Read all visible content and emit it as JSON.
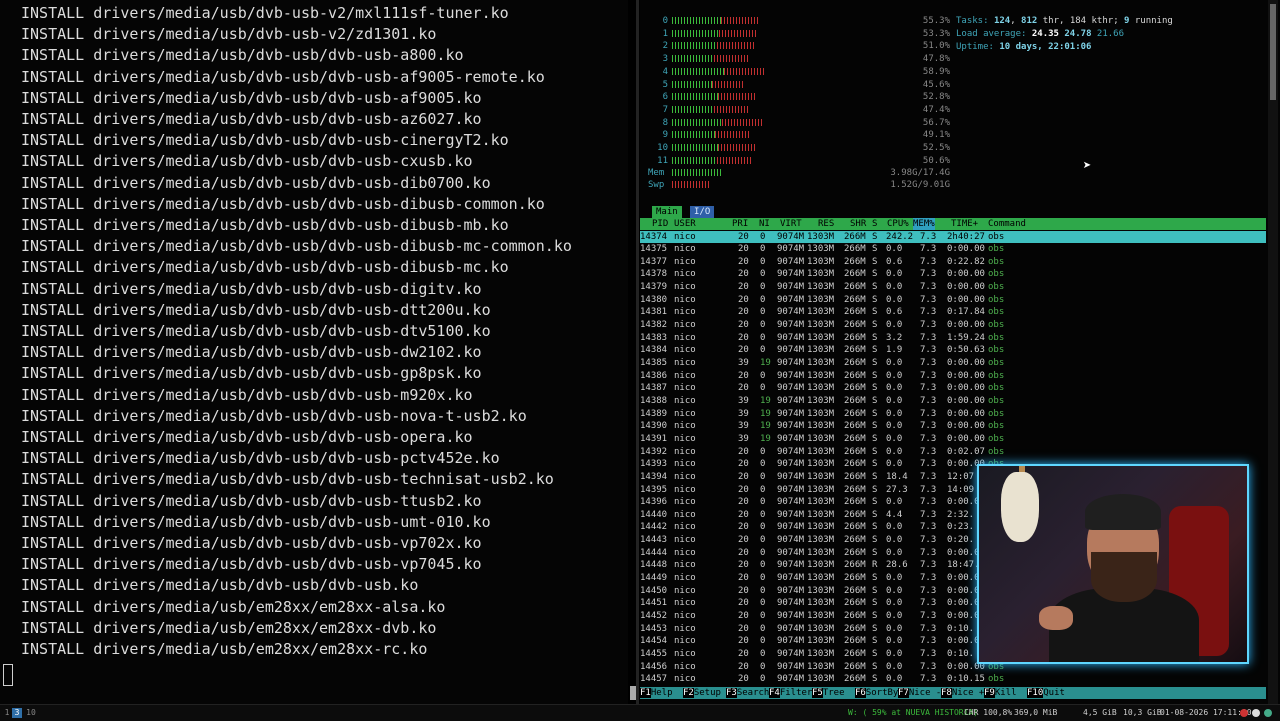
{
  "left_terminal": {
    "lines": [
      "INSTALL drivers/media/usb/dvb-usb-v2/mxl111sf-tuner.ko",
      "INSTALL drivers/media/usb/dvb-usb-v2/zd1301.ko",
      "INSTALL drivers/media/usb/dvb-usb/dvb-usb-a800.ko",
      "INSTALL drivers/media/usb/dvb-usb/dvb-usb-af9005-remote.ko",
      "INSTALL drivers/media/usb/dvb-usb/dvb-usb-af9005.ko",
      "INSTALL drivers/media/usb/dvb-usb/dvb-usb-az6027.ko",
      "INSTALL drivers/media/usb/dvb-usb/dvb-usb-cinergyT2.ko",
      "INSTALL drivers/media/usb/dvb-usb/dvb-usb-cxusb.ko",
      "INSTALL drivers/media/usb/dvb-usb/dvb-usb-dib0700.ko",
      "INSTALL drivers/media/usb/dvb-usb/dvb-usb-dibusb-common.ko",
      "INSTALL drivers/media/usb/dvb-usb/dvb-usb-dibusb-mb.ko",
      "INSTALL drivers/media/usb/dvb-usb/dvb-usb-dibusb-mc-common.ko",
      "INSTALL drivers/media/usb/dvb-usb/dvb-usb-dibusb-mc.ko",
      "INSTALL drivers/media/usb/dvb-usb/dvb-usb-digitv.ko",
      "INSTALL drivers/media/usb/dvb-usb/dvb-usb-dtt200u.ko",
      "INSTALL drivers/media/usb/dvb-usb/dvb-usb-dtv5100.ko",
      "INSTALL drivers/media/usb/dvb-usb/dvb-usb-dw2102.ko",
      "INSTALL drivers/media/usb/dvb-usb/dvb-usb-gp8psk.ko",
      "INSTALL drivers/media/usb/dvb-usb/dvb-usb-m920x.ko",
      "INSTALL drivers/media/usb/dvb-usb/dvb-usb-nova-t-usb2.ko",
      "INSTALL drivers/media/usb/dvb-usb/dvb-usb-opera.ko",
      "INSTALL drivers/media/usb/dvb-usb/dvb-usb-pctv452e.ko",
      "INSTALL drivers/media/usb/dvb-usb/dvb-usb-technisat-usb2.ko",
      "INSTALL drivers/media/usb/dvb-usb/dvb-usb-ttusb2.ko",
      "INSTALL drivers/media/usb/dvb-usb/dvb-usb-umt-010.ko",
      "INSTALL drivers/media/usb/dvb-usb/dvb-usb-vp702x.ko",
      "INSTALL drivers/media/usb/dvb-usb/dvb-usb-vp7045.ko",
      "INSTALL drivers/media/usb/dvb-usb/dvb-usb.ko",
      "INSTALL drivers/media/usb/em28xx/em28xx-alsa.ko",
      "INSTALL drivers/media/usb/em28xx/em28xx-dvb.ko",
      "INSTALL drivers/media/usb/em28xx/em28xx-rc.ko"
    ]
  },
  "htop": {
    "cpus": [
      {
        "id": "0",
        "pct": "55.3%",
        "usage": 0.553
      },
      {
        "id": "1",
        "pct": "53.3%",
        "usage": 0.533
      },
      {
        "id": "2",
        "pct": "51.0%",
        "usage": 0.51
      },
      {
        "id": "3",
        "pct": "47.8%",
        "usage": 0.478
      },
      {
        "id": "4",
        "pct": "58.9%",
        "usage": 0.589
      },
      {
        "id": "5",
        "pct": "45.6%",
        "usage": 0.456
      },
      {
        "id": "6",
        "pct": "52.8%",
        "usage": 0.528
      },
      {
        "id": "7",
        "pct": "47.4%",
        "usage": 0.474
      },
      {
        "id": "8",
        "pct": "56.7%",
        "usage": 0.567
      },
      {
        "id": "9",
        "pct": "49.1%",
        "usage": 0.491
      },
      {
        "id": "10",
        "pct": "52.5%",
        "usage": 0.525
      },
      {
        "id": "11",
        "pct": "50.6%",
        "usage": 0.506
      }
    ],
    "mem": {
      "label": "Mem",
      "value": "3.98G/17.4G",
      "usage": 0.229
    },
    "swp": {
      "label": "Swp",
      "value": "1.52G/9.01G",
      "usage": 0.169
    },
    "tasks": {
      "label": "Tasks:",
      "count": "124",
      "sep1": ", ",
      "thr": "812",
      "thr_label": " thr, ",
      "kthr": "184 kthr",
      "sep2": "; ",
      "running": "9",
      "running_label": " running"
    },
    "load": {
      "label": "Load average:",
      "v1": "24.35",
      "v2": "24.78",
      "v3": "21.66"
    },
    "uptime": {
      "label": "Uptime:",
      "value": "10 days, 22:01:06"
    },
    "tabs": [
      "Main",
      "I/O"
    ],
    "columns": [
      "PID",
      "USER",
      "PRI",
      "NI",
      "VIRT",
      "RES",
      "SHR",
      "S",
      "CPU%",
      "MEM%",
      "TIME+",
      "Command"
    ],
    "processes": [
      {
        "pid": "14374",
        "user": "nico",
        "pri": "20",
        "ni": "0",
        "virt": "9074M",
        "res": "1303M",
        "shr": "266M",
        "s": "S",
        "cpu": "242.2",
        "mem": "7.3",
        "time": "2h40:27",
        "cmd": "obs"
      },
      {
        "pid": "14375",
        "user": "nico",
        "pri": "20",
        "ni": "0",
        "virt": "9074M",
        "res": "1303M",
        "shr": "266M",
        "s": "S",
        "cpu": "0.0",
        "mem": "7.3",
        "time": "0:00.00",
        "cmd": "obs"
      },
      {
        "pid": "14377",
        "user": "nico",
        "pri": "20",
        "ni": "0",
        "virt": "9074M",
        "res": "1303M",
        "shr": "266M",
        "s": "S",
        "cpu": "0.6",
        "mem": "7.3",
        "time": "0:22.82",
        "cmd": "obs"
      },
      {
        "pid": "14378",
        "user": "nico",
        "pri": "20",
        "ni": "0",
        "virt": "9074M",
        "res": "1303M",
        "shr": "266M",
        "s": "S",
        "cpu": "0.0",
        "mem": "7.3",
        "time": "0:00.00",
        "cmd": "obs"
      },
      {
        "pid": "14379",
        "user": "nico",
        "pri": "20",
        "ni": "0",
        "virt": "9074M",
        "res": "1303M",
        "shr": "266M",
        "s": "S",
        "cpu": "0.0",
        "mem": "7.3",
        "time": "0:00.00",
        "cmd": "obs"
      },
      {
        "pid": "14380",
        "user": "nico",
        "pri": "20",
        "ni": "0",
        "virt": "9074M",
        "res": "1303M",
        "shr": "266M",
        "s": "S",
        "cpu": "0.0",
        "mem": "7.3",
        "time": "0:00.00",
        "cmd": "obs"
      },
      {
        "pid": "14381",
        "user": "nico",
        "pri": "20",
        "ni": "0",
        "virt": "9074M",
        "res": "1303M",
        "shr": "266M",
        "s": "S",
        "cpu": "0.6",
        "mem": "7.3",
        "time": "0:17.84",
        "cmd": "obs"
      },
      {
        "pid": "14382",
        "user": "nico",
        "pri": "20",
        "ni": "0",
        "virt": "9074M",
        "res": "1303M",
        "shr": "266M",
        "s": "S",
        "cpu": "0.0",
        "mem": "7.3",
        "time": "0:00.00",
        "cmd": "obs"
      },
      {
        "pid": "14383",
        "user": "nico",
        "pri": "20",
        "ni": "0",
        "virt": "9074M",
        "res": "1303M",
        "shr": "266M",
        "s": "S",
        "cpu": "3.2",
        "mem": "7.3",
        "time": "1:59.24",
        "cmd": "obs"
      },
      {
        "pid": "14384",
        "user": "nico",
        "pri": "20",
        "ni": "0",
        "virt": "9074M",
        "res": "1303M",
        "shr": "266M",
        "s": "S",
        "cpu": "1.9",
        "mem": "7.3",
        "time": "0:50.63",
        "cmd": "obs"
      },
      {
        "pid": "14385",
        "user": "nico",
        "pri": "39",
        "ni": "19",
        "virt": "9074M",
        "res": "1303M",
        "shr": "266M",
        "s": "S",
        "cpu": "0.0",
        "mem": "7.3",
        "time": "0:00.00",
        "cmd": "obs"
      },
      {
        "pid": "14386",
        "user": "nico",
        "pri": "20",
        "ni": "0",
        "virt": "9074M",
        "res": "1303M",
        "shr": "266M",
        "s": "S",
        "cpu": "0.0",
        "mem": "7.3",
        "time": "0:00.00",
        "cmd": "obs"
      },
      {
        "pid": "14387",
        "user": "nico",
        "pri": "20",
        "ni": "0",
        "virt": "9074M",
        "res": "1303M",
        "shr": "266M",
        "s": "S",
        "cpu": "0.0",
        "mem": "7.3",
        "time": "0:00.00",
        "cmd": "obs"
      },
      {
        "pid": "14388",
        "user": "nico",
        "pri": "39",
        "ni": "19",
        "virt": "9074M",
        "res": "1303M",
        "shr": "266M",
        "s": "S",
        "cpu": "0.0",
        "mem": "7.3",
        "time": "0:00.00",
        "cmd": "obs"
      },
      {
        "pid": "14389",
        "user": "nico",
        "pri": "39",
        "ni": "19",
        "virt": "9074M",
        "res": "1303M",
        "shr": "266M",
        "s": "S",
        "cpu": "0.0",
        "mem": "7.3",
        "time": "0:00.00",
        "cmd": "obs"
      },
      {
        "pid": "14390",
        "user": "nico",
        "pri": "39",
        "ni": "19",
        "virt": "9074M",
        "res": "1303M",
        "shr": "266M",
        "s": "S",
        "cpu": "0.0",
        "mem": "7.3",
        "time": "0:00.00",
        "cmd": "obs"
      },
      {
        "pid": "14391",
        "user": "nico",
        "pri": "39",
        "ni": "19",
        "virt": "9074M",
        "res": "1303M",
        "shr": "266M",
        "s": "S",
        "cpu": "0.0",
        "mem": "7.3",
        "time": "0:00.00",
        "cmd": "obs"
      },
      {
        "pid": "14392",
        "user": "nico",
        "pri": "20",
        "ni": "0",
        "virt": "9074M",
        "res": "1303M",
        "shr": "266M",
        "s": "S",
        "cpu": "0.0",
        "mem": "7.3",
        "time": "0:02.07",
        "cmd": "obs"
      },
      {
        "pid": "14393",
        "user": "nico",
        "pri": "20",
        "ni": "0",
        "virt": "9074M",
        "res": "1303M",
        "shr": "266M",
        "s": "S",
        "cpu": "0.0",
        "mem": "7.3",
        "time": "0:00.00",
        "cmd": "obs"
      },
      {
        "pid": "14394",
        "user": "nico",
        "pri": "20",
        "ni": "0",
        "virt": "9074M",
        "res": "1303M",
        "shr": "266M",
        "s": "S",
        "cpu": "18.4",
        "mem": "7.3",
        "time": "12:07",
        "cmd": ""
      },
      {
        "pid": "14395",
        "user": "nico",
        "pri": "20",
        "ni": "0",
        "virt": "9074M",
        "res": "1303M",
        "shr": "266M",
        "s": "S",
        "cpu": "27.3",
        "mem": "7.3",
        "time": "14:09",
        "cmd": ""
      },
      {
        "pid": "14396",
        "user": "nico",
        "pri": "20",
        "ni": "0",
        "virt": "9074M",
        "res": "1303M",
        "shr": "266M",
        "s": "S",
        "cpu": "0.0",
        "mem": "7.3",
        "time": "0:00.0",
        "cmd": ""
      },
      {
        "pid": "14440",
        "user": "nico",
        "pri": "20",
        "ni": "0",
        "virt": "9074M",
        "res": "1303M",
        "shr": "266M",
        "s": "S",
        "cpu": "4.4",
        "mem": "7.3",
        "time": "2:32.",
        "cmd": ""
      },
      {
        "pid": "14442",
        "user": "nico",
        "pri": "20",
        "ni": "0",
        "virt": "9074M",
        "res": "1303M",
        "shr": "266M",
        "s": "S",
        "cpu": "0.0",
        "mem": "7.3",
        "time": "0:23.",
        "cmd": ""
      },
      {
        "pid": "14443",
        "user": "nico",
        "pri": "20",
        "ni": "0",
        "virt": "9074M",
        "res": "1303M",
        "shr": "266M",
        "s": "S",
        "cpu": "0.0",
        "mem": "7.3",
        "time": "0:20.",
        "cmd": ""
      },
      {
        "pid": "14444",
        "user": "nico",
        "pri": "20",
        "ni": "0",
        "virt": "9074M",
        "res": "1303M",
        "shr": "266M",
        "s": "S",
        "cpu": "0.0",
        "mem": "7.3",
        "time": "0:00.0",
        "cmd": ""
      },
      {
        "pid": "14448",
        "user": "nico",
        "pri": "20",
        "ni": "0",
        "virt": "9074M",
        "res": "1303M",
        "shr": "266M",
        "s": "R",
        "cpu": "28.6",
        "mem": "7.3",
        "time": "18:47.",
        "cmd": ""
      },
      {
        "pid": "14449",
        "user": "nico",
        "pri": "20",
        "ni": "0",
        "virt": "9074M",
        "res": "1303M",
        "shr": "266M",
        "s": "S",
        "cpu": "0.0",
        "mem": "7.3",
        "time": "0:00.0",
        "cmd": ""
      },
      {
        "pid": "14450",
        "user": "nico",
        "pri": "20",
        "ni": "0",
        "virt": "9074M",
        "res": "1303M",
        "shr": "266M",
        "s": "S",
        "cpu": "0.0",
        "mem": "7.3",
        "time": "0:00.0",
        "cmd": ""
      },
      {
        "pid": "14451",
        "user": "nico",
        "pri": "20",
        "ni": "0",
        "virt": "9074M",
        "res": "1303M",
        "shr": "266M",
        "s": "S",
        "cpu": "0.0",
        "mem": "7.3",
        "time": "0:00.0",
        "cmd": ""
      },
      {
        "pid": "14452",
        "user": "nico",
        "pri": "20",
        "ni": "0",
        "virt": "9074M",
        "res": "1303M",
        "shr": "266M",
        "s": "S",
        "cpu": "0.0",
        "mem": "7.3",
        "time": "0:00.0",
        "cmd": ""
      },
      {
        "pid": "14453",
        "user": "nico",
        "pri": "20",
        "ni": "0",
        "virt": "9074M",
        "res": "1303M",
        "shr": "266M",
        "s": "S",
        "cpu": "0.0",
        "mem": "7.3",
        "time": "0:10.",
        "cmd": ""
      },
      {
        "pid": "14454",
        "user": "nico",
        "pri": "20",
        "ni": "0",
        "virt": "9074M",
        "res": "1303M",
        "shr": "266M",
        "s": "S",
        "cpu": "0.0",
        "mem": "7.3",
        "time": "0:00.0",
        "cmd": ""
      },
      {
        "pid": "14455",
        "user": "nico",
        "pri": "20",
        "ni": "0",
        "virt": "9074M",
        "res": "1303M",
        "shr": "266M",
        "s": "S",
        "cpu": "0.0",
        "mem": "7.3",
        "time": "0:10.",
        "cmd": ""
      },
      {
        "pid": "14456",
        "user": "nico",
        "pri": "20",
        "ni": "0",
        "virt": "9074M",
        "res": "1303M",
        "shr": "266M",
        "s": "S",
        "cpu": "0.0",
        "mem": "7.3",
        "time": "0:00.00",
        "cmd": "obs"
      },
      {
        "pid": "14457",
        "user": "nico",
        "pri": "20",
        "ni": "0",
        "virt": "9074M",
        "res": "1303M",
        "shr": "266M",
        "s": "S",
        "cpu": "0.0",
        "mem": "7.3",
        "time": "0:10.15",
        "cmd": "obs"
      }
    ],
    "fkeys": [
      {
        "k": "F1",
        "n": "Help"
      },
      {
        "k": "F2",
        "n": "Setup"
      },
      {
        "k": "F3",
        "n": "Search"
      },
      {
        "k": "F4",
        "n": "Filter"
      },
      {
        "k": "F5",
        "n": "Tree"
      },
      {
        "k": "F6",
        "n": "SortBy"
      },
      {
        "k": "F7",
        "n": "Nice -"
      },
      {
        "k": "F8",
        "n": "Nice +"
      },
      {
        "k": "F9",
        "n": "Kill"
      },
      {
        "k": "F10",
        "n": "Quit"
      }
    ]
  },
  "status_bar": {
    "workspaces": [
      "1",
      "3",
      "10"
    ],
    "active_workspace": "3",
    "wifi": "W: ( 59% at NUEVA HISTORIA)",
    "cpu": "CHR 100,8%",
    "mem_used": "369,0 MiB",
    "disk1": "4,5 GiB",
    "disk2": "10,3 GiB",
    "datetime": "01-08-2026 17:11:10"
  },
  "colors": {
    "accent_green": "#2ea84a",
    "selected_row": "#3fbfbf",
    "fkey_bar": "#2a8f8f",
    "webcam_border": "#5fd7ff"
  }
}
